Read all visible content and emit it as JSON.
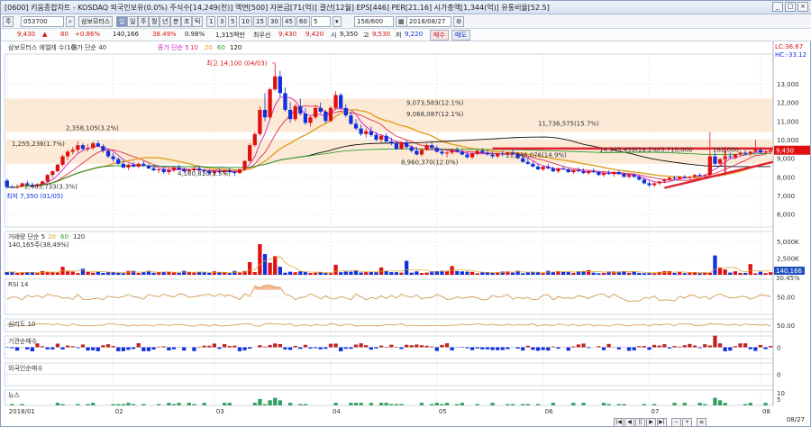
{
  "window": {
    "title": "[0600] 키움종합차트 - KOSDAQ 외국인보유(0.0%)  주식수[14,249(천)]  액면[500]  자본금[71(억)]  결산[12월]  EPS[446]  PER[21.16]  시가총액[1,344(억)]  유통비율[52.5]",
    "controls": [
      "_",
      "□",
      "×"
    ]
  },
  "toolbar": {
    "period_button": "주",
    "code": "053700",
    "stock_name": "삼보모터스",
    "tag": "업",
    "intervals": [
      "일",
      "주",
      "월",
      "년",
      "분",
      "초",
      "틱"
    ],
    "minutes": [
      "1",
      "3",
      "5",
      "10",
      "15",
      "30",
      "45",
      "60"
    ],
    "selected_minute": "5",
    "count": "158/600",
    "date": "2018/08/27"
  },
  "pricebar": {
    "price": "9,430",
    "arrow": "▲",
    "change": "80",
    "change_pct": "+0.86%",
    "volume": "140,166",
    "vol_ratio": "38.49%",
    "turnover": "0.98%",
    "amount": "1,315백만",
    "best_ask_label": "최우선",
    "best_ask": "9,430",
    "best_bid": "9,420",
    "open_label": "시",
    "open": "9,350",
    "high_label": "고",
    "high": "9,530",
    "low_label": "저",
    "low": "9,220",
    "buy_btn": "매수",
    "sell_btn": "매도"
  },
  "colors": {
    "up": "#e01010",
    "down": "#1030e0",
    "ma5": "#d020c0",
    "ma10": "#e03050",
    "ma20": "#e0a020",
    "ma60": "#101010",
    "ma120": "#30a030",
    "rsi": "#d09040",
    "psy": "#d09040",
    "inst": "#c02020",
    "news": "#30a060",
    "band": "#fbe6cf",
    "trend": "#e02030"
  },
  "chart_data": {
    "type": "candlestick",
    "x_axis": {
      "labels": [
        "2018/01",
        "02",
        "03",
        "04",
        "05",
        "06",
        "07",
        "08"
      ],
      "end_label": "08/27"
    },
    "main": {
      "legend": [
        "삼보모터스 에엘레 수(10)",
        "종가 단순 40",
        "종가 단순 5",
        "10",
        "20",
        "60",
        "120"
      ],
      "y_ticks": [
        6000,
        7000,
        8000,
        9000,
        10000,
        11000,
        12000,
        13000
      ],
      "y_tick_labels": [
        "6,000",
        "7,000",
        "8,000",
        "9,000",
        "10,000",
        "11,000",
        "12,000",
        "13,000"
      ],
      "ylim": [
        5300,
        14600
      ],
      "corner_labels": [
        "LC:36.67",
        "HC:-33.12"
      ],
      "current_price_label": "9,430",
      "high_label": "최고 14,100 (04/03)",
      "low_label": "최저 7,350 (01/05)",
      "high_value": 14100,
      "low_value": 7350,
      "bands": [
        {
          "lo": 8700,
          "hi": 9400
        },
        {
          "lo": 10400,
          "hi": 12200
        },
        {
          "lo": 9400,
          "hi": 10000
        }
      ],
      "volume_profile_labels": [
        {
          "text": "1,255,236(1.7%)",
          "price": 9800
        },
        {
          "text": "2,358,105(3.2%)",
          "price": 10650
        },
        {
          "text": "2,465,733(3.3%)",
          "price": 7500
        },
        {
          "text": "4,100,810(5.5%)",
          "price": 8200
        },
        {
          "text": "9,073,583(12.1%)",
          "price": 12000
        },
        {
          "text": "9,068,087(12.1%)",
          "price": 11400
        },
        {
          "text": "11,736,575(15.7%)",
          "price": 10900
        },
        {
          "text": "8,960,370(12.0%)",
          "price": 8800
        },
        {
          "text": "11,146,076(14.9%)",
          "price": 9200
        },
        {
          "text": "14,345,459(19.2%)",
          "price": 9500
        },
        {
          "text": "5,710,000",
          "price": 9500
        },
        {
          "text": "182,000",
          "price": 9500
        }
      ],
      "resistance_level": 9520,
      "trendline": {
        "start_date": "2018/07/20",
        "start_value": 7400,
        "end_date": "2018/08/27",
        "end_value": 8800
      }
    },
    "volume": {
      "legend": [
        "거래량 단순 5",
        "20",
        "60",
        "120"
      ],
      "current_label": "140,165주(38,49%)",
      "y_tick_labels": [
        "5,000K",
        "2,500K"
      ],
      "ylim": [
        0,
        6500
      ],
      "current_value": "140,166",
      "pct_label": "30.45%"
    },
    "rsi": {
      "legend": "RSI 14",
      "tick_label": "50.00",
      "ylim": [
        0,
        100
      ]
    },
    "psy": {
      "legend": "심리도 10",
      "tick_label": "50.00",
      "ylim": [
        0,
        100
      ]
    },
    "inst": {
      "legend": "기관순매수",
      "tick_label": "0"
    },
    "foreign": {
      "legend": "외국인순매수",
      "tick_label": "0"
    },
    "news": {
      "legend": "뉴스",
      "tick_labels": [
        "10",
        "5"
      ],
      "ylim": [
        0,
        12
      ]
    },
    "ohlc": [
      [
        7800,
        7900,
        7350,
        7450
      ],
      [
        7450,
        7550,
        7380,
        7420
      ],
      [
        7420,
        7600,
        7350,
        7480
      ],
      [
        7480,
        7700,
        7420,
        7650
      ],
      [
        7650,
        7800,
        7500,
        7560
      ],
      [
        7560,
        7700,
        7450,
        7500
      ],
      [
        7500,
        7650,
        7400,
        7600
      ],
      [
        7600,
        7800,
        7550,
        7750
      ],
      [
        7750,
        8150,
        7700,
        8100
      ],
      [
        8100,
        8350,
        7950,
        8300
      ],
      [
        8300,
        8700,
        8250,
        8650
      ],
      [
        8650,
        9200,
        8550,
        9100
      ],
      [
        9100,
        9450,
        8900,
        9350
      ],
      [
        9350,
        9600,
        9200,
        9450
      ],
      [
        9450,
        9900,
        9300,
        9700
      ],
      [
        9700,
        9800,
        9400,
        9500
      ],
      [
        9500,
        9750,
        9350,
        9550
      ],
      [
        9550,
        9900,
        9450,
        9800
      ],
      [
        9800,
        9950,
        9600,
        9650
      ],
      [
        9650,
        9750,
        9300,
        9400
      ],
      [
        9400,
        9500,
        9000,
        9100
      ],
      [
        9100,
        9300,
        8800,
        8950
      ],
      [
        8950,
        9050,
        8650,
        8700
      ],
      [
        8700,
        8900,
        8450,
        8500
      ],
      [
        8500,
        8700,
        8350,
        8650
      ],
      [
        8650,
        8800,
        8500,
        8550
      ],
      [
        8550,
        8750,
        8450,
        8700
      ],
      [
        8700,
        8850,
        8550,
        8600
      ],
      [
        8600,
        8700,
        8400,
        8450
      ],
      [
        8450,
        8600,
        8300,
        8350
      ],
      [
        8350,
        8500,
        8200,
        8400
      ],
      [
        8400,
        8500,
        8150,
        8250
      ],
      [
        8250,
        8450,
        8100,
        8350
      ],
      [
        8350,
        8550,
        8250,
        8500
      ],
      [
        8500,
        8650,
        8350,
        8400
      ],
      [
        8400,
        8500,
        8200,
        8300
      ],
      [
        8300,
        8450,
        8150,
        8350
      ],
      [
        8350,
        8550,
        8250,
        8450
      ],
      [
        8450,
        8600,
        8300,
        8350
      ],
      [
        8350,
        8450,
        8150,
        8300
      ],
      [
        8300,
        8400,
        8100,
        8200
      ],
      [
        8200,
        8350,
        8050,
        8300
      ],
      [
        8300,
        8450,
        8150,
        8250
      ],
      [
        8250,
        8400,
        8100,
        8350
      ],
      [
        8350,
        8500,
        8200,
        8250
      ],
      [
        8250,
        8350,
        8050,
        8200
      ],
      [
        8200,
        8450,
        8150,
        8400
      ],
      [
        8400,
        8900,
        8350,
        8850
      ],
      [
        8850,
        9800,
        8800,
        9700
      ],
      [
        9700,
        10400,
        9600,
        10300
      ],
      [
        10300,
        11800,
        10200,
        11600
      ],
      [
        11600,
        12500,
        11000,
        11200
      ],
      [
        11200,
        12800,
        11100,
        12700
      ],
      [
        12700,
        14100,
        12600,
        13400
      ],
      [
        13400,
        13700,
        12300,
        12500
      ],
      [
        12500,
        12800,
        11500,
        11600
      ],
      [
        11600,
        12000,
        10900,
        11100
      ],
      [
        11100,
        11900,
        11000,
        11800
      ],
      [
        11800,
        12200,
        11300,
        11400
      ],
      [
        11400,
        11700,
        10800,
        10900
      ],
      [
        10900,
        11300,
        10700,
        11200
      ],
      [
        11200,
        11800,
        11100,
        11700
      ],
      [
        11700,
        12000,
        11400,
        11500
      ],
      [
        11500,
        11600,
        10900,
        11000
      ],
      [
        11000,
        11800,
        10950,
        11700
      ],
      [
        11700,
        12600,
        11600,
        12400
      ],
      [
        12400,
        12500,
        11600,
        11700
      ],
      [
        11700,
        11900,
        11200,
        11300
      ],
      [
        11300,
        11500,
        10800,
        10850
      ],
      [
        10850,
        11100,
        10500,
        10600
      ],
      [
        10600,
        10800,
        10200,
        10300
      ],
      [
        10300,
        10600,
        10100,
        10450
      ],
      [
        10450,
        10700,
        10150,
        10250
      ],
      [
        10250,
        10400,
        9900,
        10000
      ],
      [
        10000,
        10300,
        9850,
        10200
      ],
      [
        10200,
        10350,
        9800,
        9900
      ],
      [
        9900,
        10100,
        9700,
        9800
      ],
      [
        9800,
        9950,
        9450,
        9500
      ],
      [
        9500,
        9900,
        9450,
        9850
      ],
      [
        9850,
        10000,
        9500,
        9600
      ],
      [
        9600,
        9700,
        9300,
        9400
      ],
      [
        9400,
        9600,
        9150,
        9200
      ],
      [
        9200,
        9500,
        9100,
        9450
      ],
      [
        9450,
        9800,
        9400,
        9700
      ],
      [
        9700,
        9900,
        9500,
        9550
      ],
      [
        9550,
        9700,
        9300,
        9350
      ],
      [
        9350,
        9500,
        9150,
        9250
      ],
      [
        9250,
        9400,
        9050,
        9300
      ],
      [
        9300,
        9500,
        9200,
        9450
      ],
      [
        9450,
        9600,
        9300,
        9350
      ],
      [
        9350,
        9500,
        9150,
        9200
      ],
      [
        9200,
        9350,
        9000,
        9050
      ],
      [
        9050,
        9300,
        8950,
        9250
      ],
      [
        9250,
        9450,
        9150,
        9400
      ],
      [
        9400,
        9550,
        9250,
        9300
      ],
      [
        9300,
        9450,
        9150,
        9200
      ],
      [
        9200,
        9350,
        9000,
        9100
      ],
      [
        9100,
        9300,
        9000,
        9250
      ],
      [
        9250,
        9400,
        9100,
        9200
      ],
      [
        9200,
        9350,
        9050,
        9300
      ],
      [
        9300,
        9450,
        9150,
        9250
      ],
      [
        9250,
        9300,
        8950,
        9000
      ],
      [
        9000,
        9150,
        8750,
        8800
      ],
      [
        8800,
        9000,
        8650,
        8700
      ],
      [
        8700,
        8850,
        8500,
        8550
      ],
      [
        8550,
        8700,
        8350,
        8400
      ],
      [
        8400,
        8600,
        8300,
        8550
      ],
      [
        8550,
        8700,
        8400,
        8450
      ],
      [
        8450,
        8550,
        8250,
        8300
      ],
      [
        8300,
        8500,
        8200,
        8450
      ],
      [
        8450,
        8600,
        8350,
        8400
      ],
      [
        8400,
        8500,
        8200,
        8250
      ],
      [
        8250,
        8400,
        8150,
        8350
      ],
      [
        8350,
        8500,
        8250,
        8300
      ],
      [
        8300,
        8450,
        8150,
        8200
      ],
      [
        8200,
        8350,
        8100,
        8300
      ],
      [
        8300,
        8450,
        8200,
        8250
      ],
      [
        8250,
        8350,
        8050,
        8100
      ],
      [
        8100,
        8250,
        8000,
        8200
      ],
      [
        8200,
        8350,
        8100,
        8150
      ],
      [
        8150,
        8300,
        8000,
        8250
      ],
      [
        8250,
        8350,
        8100,
        8150
      ],
      [
        8150,
        8250,
        7950,
        8000
      ],
      [
        8000,
        8150,
        7900,
        8100
      ],
      [
        8100,
        8200,
        7950,
        8000
      ],
      [
        8000,
        8100,
        7800,
        7850
      ],
      [
        7850,
        7950,
        7600,
        7650
      ],
      [
        7650,
        7800,
        7450,
        7550
      ],
      [
        7550,
        7700,
        7450,
        7650
      ],
      [
        7650,
        7800,
        7550,
        7750
      ],
      [
        7750,
        7900,
        7650,
        7850
      ],
      [
        7850,
        8000,
        7750,
        7950
      ],
      [
        7950,
        8050,
        7800,
        7900
      ],
      [
        7900,
        8050,
        7850,
        8000
      ],
      [
        8000,
        8100,
        7900,
        7950
      ],
      [
        7950,
        8050,
        7850,
        8000
      ],
      [
        8000,
        8150,
        7950,
        8100
      ],
      [
        8100,
        8200,
        8000,
        8050
      ],
      [
        8050,
        8150,
        7950,
        8100
      ],
      [
        8100,
        10400,
        8050,
        9100
      ],
      [
        9100,
        9300,
        8600,
        8700
      ],
      [
        8700,
        9000,
        8550,
        8950
      ],
      [
        8950,
        9200,
        8850,
        9100
      ],
      [
        9100,
        9300,
        8950,
        9050
      ],
      [
        9050,
        9250,
        8950,
        9200
      ],
      [
        9200,
        9400,
        9100,
        9300
      ],
      [
        9300,
        9450,
        9150,
        9250
      ],
      [
        9250,
        9400,
        9100,
        9350
      ],
      [
        9350,
        10000,
        9300,
        9450
      ],
      [
        9450,
        9600,
        9250,
        9300
      ],
      [
        9300,
        9450,
        9200,
        9350
      ],
      [
        9350,
        9530,
        9220,
        9430
      ]
    ]
  }
}
